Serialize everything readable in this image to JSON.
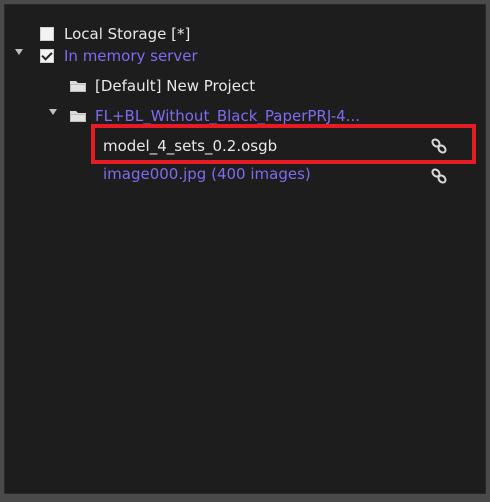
{
  "tree": {
    "local_storage": {
      "label": "Local Storage [*]",
      "checked": false
    },
    "in_memory_server": {
      "label": "In memory server",
      "checked": true,
      "expanded": true
    },
    "default_project": {
      "label": "[Default] New Project"
    },
    "fl_project": {
      "label": "FL+BL_Without_Black_PaperPRJ-4...",
      "expanded": true
    },
    "model_item": {
      "label": "model_4_sets_0.2.osgb",
      "icon": "link-icon"
    },
    "image_item": {
      "label": "image000.jpg (400 images)",
      "icon": "link-icon"
    }
  },
  "colors": {
    "panel_background": "#1d1d1d",
    "text_white": "#e8e8e8",
    "text_blue": "#7d6cf0",
    "highlight_red": "#e51c23"
  }
}
